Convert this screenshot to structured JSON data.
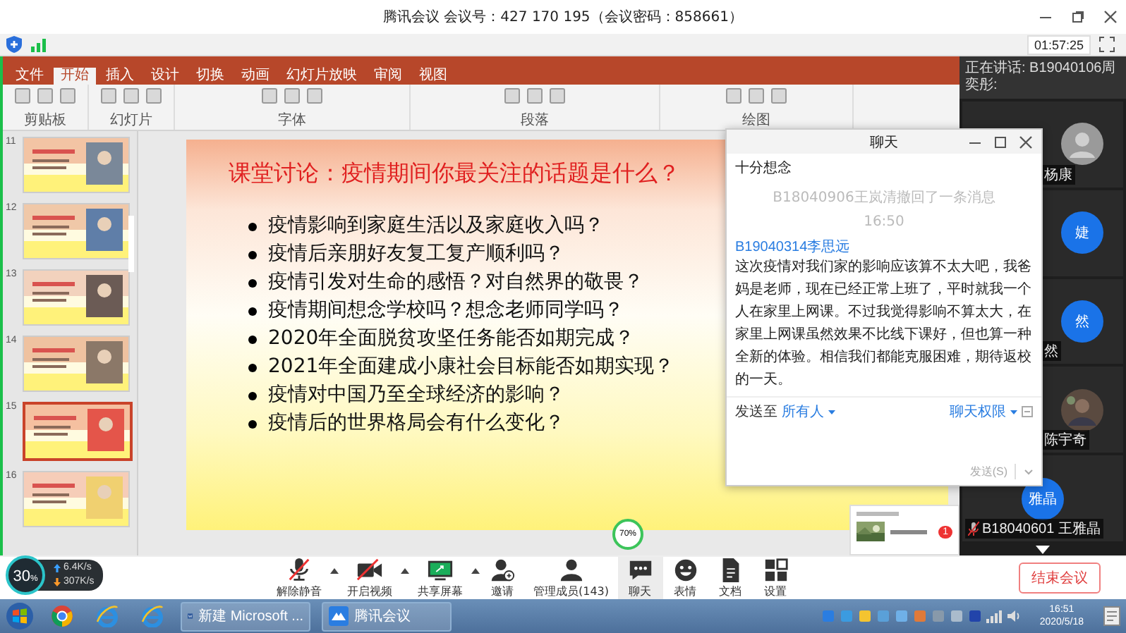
{
  "window": {
    "title": "腾讯会议 会议号：427 170 195（会议密码：858661）",
    "timer": "01:57:25"
  },
  "ppt": {
    "tabs": [
      {
        "label": "文件",
        "selected": false
      },
      {
        "label": "开始",
        "selected": true
      },
      {
        "label": "插入",
        "selected": false
      },
      {
        "label": "设计",
        "selected": false
      },
      {
        "label": "切换",
        "selected": false
      },
      {
        "label": "动画",
        "selected": false
      },
      {
        "label": "幻灯片放映",
        "selected": false
      },
      {
        "label": "审阅",
        "selected": false
      },
      {
        "label": "视图",
        "selected": false
      }
    ],
    "ribbon_groups": [
      "剪贴板",
      "幻灯片",
      "字体",
      "段落",
      "绘图"
    ],
    "thumbnails": [
      {
        "number": "11",
        "selected": false
      },
      {
        "number": "12",
        "selected": false
      },
      {
        "number": "13",
        "selected": false
      },
      {
        "number": "14",
        "selected": false
      },
      {
        "number": "15",
        "selected": true
      },
      {
        "number": "16",
        "selected": false
      }
    ],
    "slide": {
      "title": "课堂讨论：疫情期间你最关注的话题是什么？",
      "bullets": [
        "疫情影响到家庭生活以及家庭收入吗？",
        "疫情后亲朋好友复工复产顺利吗？",
        "疫情引发对生命的感悟？对自然界的敬畏？",
        "疫情期间想念学校吗？想念老师同学吗？",
        "2020年全面脱贫攻坚任务能否如期完成？",
        "2021年全面建成小康社会目标能否如期实现？",
        "疫情对中国乃至全球经济的影响？",
        "疫情后的世界格局会有什么变化？"
      ]
    },
    "cpu": "70%",
    "notification": {
      "badge": "1"
    }
  },
  "chat": {
    "title": "聊天",
    "messages": [
      {
        "kind": "text",
        "text": "十分想念"
      },
      {
        "kind": "notice",
        "text": "B18040906王岚清撤回了一条消息"
      },
      {
        "kind": "time",
        "text": "16:50"
      },
      {
        "kind": "sender",
        "text": "B19040314李思远"
      },
      {
        "kind": "text",
        "text": "这次疫情对我们家的影响应该算不太大吧，我爸妈是老师，现在已经正常上班了，平时就我一个人在家里上网课。不过我觉得影响不算太大，在家里上网课虽然效果不比线下课好，但也算一种全新的体验。相信我们都能克服困难，期待返校的一天。"
      }
    ],
    "send_to_label": "发送至",
    "send_to": "所有人",
    "permissions": "聊天权限",
    "send_button": "发送(S)"
  },
  "speaker": "正在讲话: B19040106周奕彤:",
  "participants": [
    {
      "kind": "default",
      "name": "杨康"
    },
    {
      "kind": "initials",
      "avatar": "婕"
    },
    {
      "kind": "initials",
      "avatar": "然",
      "name": "然"
    },
    {
      "name": "陈宇奇"
    },
    {
      "kind": "initials",
      "avatar": "雅晶",
      "name": "B18040601 王雅晶",
      "muted": true
    }
  ],
  "toolbar": [
    {
      "kind": "mic-off",
      "label": "解除静音",
      "menu": true,
      "selected": false
    },
    {
      "kind": "video-off",
      "label": "开启视频",
      "menu": true,
      "selected": false
    },
    {
      "kind": "share",
      "label": "共享屏幕",
      "menu": true,
      "selected": false
    },
    {
      "kind": "invite",
      "label": "邀请",
      "menu": false,
      "selected": false
    },
    {
      "kind": "members",
      "label": "管理成员(143)",
      "menu": false,
      "selected": false
    },
    {
      "kind": "chat",
      "label": "聊天",
      "menu": false,
      "selected": true
    },
    {
      "kind": "emoji",
      "label": "表情",
      "menu": false,
      "selected": false
    },
    {
      "kind": "doc",
      "label": "文档",
      "menu": false,
      "selected": false
    },
    {
      "kind": "settings",
      "label": "设置",
      "menu": false,
      "selected": false
    }
  ],
  "end_button": "结束会议",
  "network": {
    "percent": "30",
    "unit": "%",
    "up": "6.4K/s",
    "down": "307K/s"
  },
  "taskbar": {
    "tasks": [
      {
        "kind": "word",
        "label": "新建 Microsoft ..."
      },
      {
        "kind": "meeting",
        "label": "腾讯会议"
      }
    ],
    "time": "16:51",
    "date": "2020/5/18"
  }
}
